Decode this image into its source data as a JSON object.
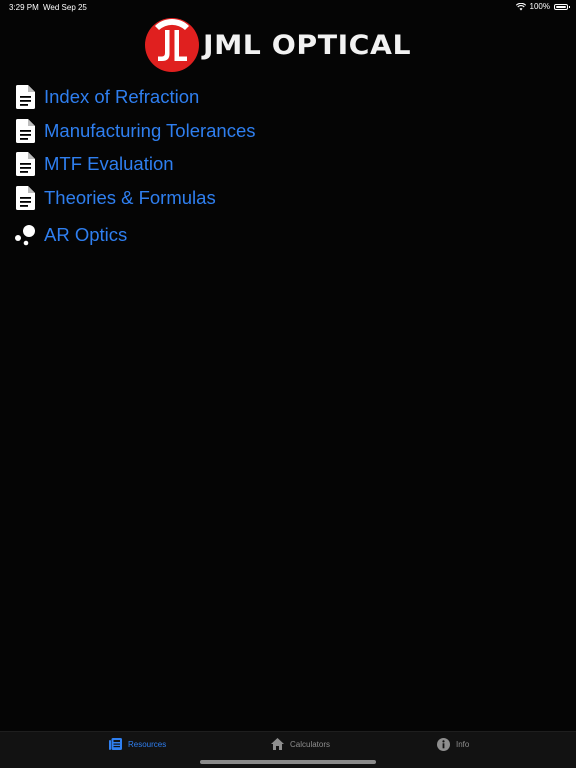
{
  "status_bar": {
    "time": "3:29 PM",
    "date": "Wed Sep 25",
    "battery": "100%",
    "battery_level": 1.0
  },
  "header": {
    "logo_text": "JML OPTICAL",
    "logo_mark_color": "#e0201f"
  },
  "resources": [
    {
      "label": "Index of Refraction",
      "icon": "document-icon"
    },
    {
      "label": "Manufacturing Tolerances",
      "icon": "document-icon"
    },
    {
      "label": "MTF Evaluation",
      "icon": "document-icon"
    },
    {
      "label": "Theories & Formulas",
      "icon": "document-icon"
    },
    {
      "label": "AR Optics",
      "icon": "bubbles-icon"
    }
  ],
  "tab_bar": {
    "tabs": [
      {
        "label": "Resources",
        "icon": "newspaper-icon",
        "active": true
      },
      {
        "label": "Calculators",
        "icon": "home-icon",
        "active": false
      },
      {
        "label": "Info",
        "icon": "info-icon",
        "active": false
      }
    ]
  },
  "colors": {
    "accent": "#2f7ff0",
    "background": "#050505",
    "inactive_tab": "#8e8e8e"
  }
}
